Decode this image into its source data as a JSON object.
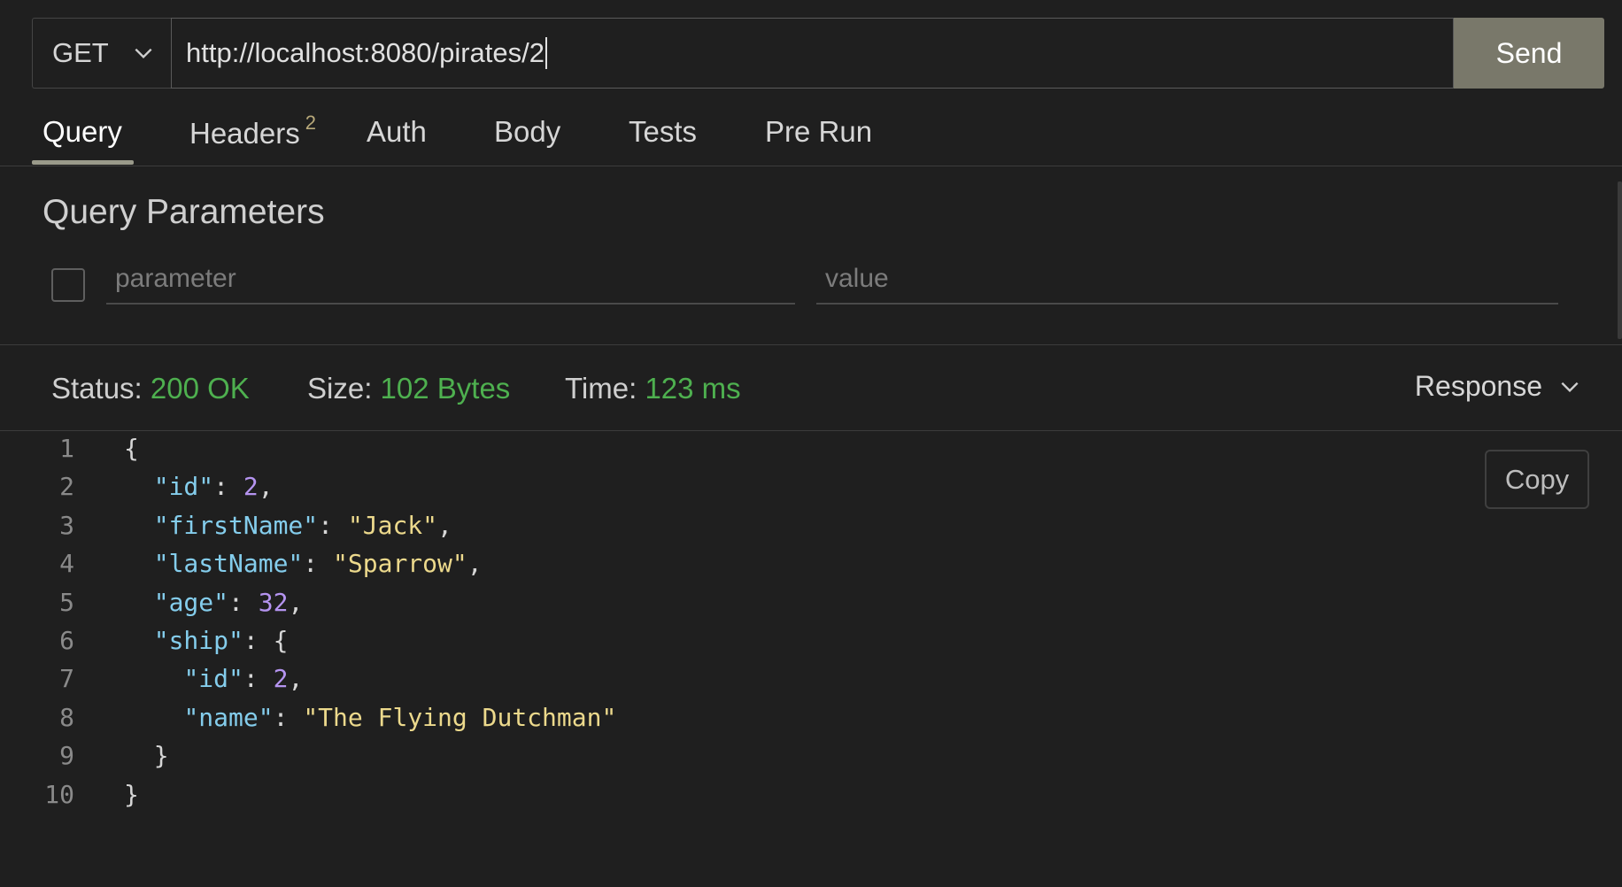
{
  "request": {
    "method": "GET",
    "url": "http://localhost:8080/pirates/2",
    "send_label": "Send"
  },
  "tabs": [
    {
      "label": "Query",
      "badge": "",
      "active": true
    },
    {
      "label": "Headers",
      "badge": "2",
      "active": false
    },
    {
      "label": "Auth",
      "badge": "",
      "active": false
    },
    {
      "label": "Body",
      "badge": "",
      "active": false
    },
    {
      "label": "Tests",
      "badge": "",
      "active": false
    },
    {
      "label": "Pre Run",
      "badge": "",
      "active": false
    }
  ],
  "query": {
    "title": "Query Parameters",
    "param_placeholder": "parameter",
    "value_placeholder": "value"
  },
  "status": {
    "status_label": "Status:",
    "status_value": "200 OK",
    "size_label": "Size:",
    "size_value": "102 Bytes",
    "time_label": "Time:",
    "time_value": "123 ms",
    "view_select": "Response"
  },
  "response": {
    "copy_label": "Copy",
    "lines": [
      {
        "number": "1",
        "code": "{"
      },
      {
        "number": "2",
        "code": "  \"id\": 2,"
      },
      {
        "number": "3",
        "code": "  \"firstName\": \"Jack\","
      },
      {
        "number": "4",
        "code": "  \"lastName\": \"Sparrow\","
      },
      {
        "number": "5",
        "code": "  \"age\": 32,"
      },
      {
        "number": "6",
        "code": "  \"ship\": {"
      },
      {
        "number": "7",
        "code": "    \"id\": 2,"
      },
      {
        "number": "8",
        "code": "    \"name\": \"The Flying Dutchman\""
      },
      {
        "number": "9",
        "code": "  }"
      },
      {
        "number": "10",
        "code": "}"
      }
    ]
  },
  "colors": {
    "send_button": "#79786a",
    "status_value": "#4eb04f",
    "json_key": "#84cdec",
    "json_string": "#ecd98c",
    "json_number": "#b594f0",
    "background": "#1f1f1f"
  }
}
